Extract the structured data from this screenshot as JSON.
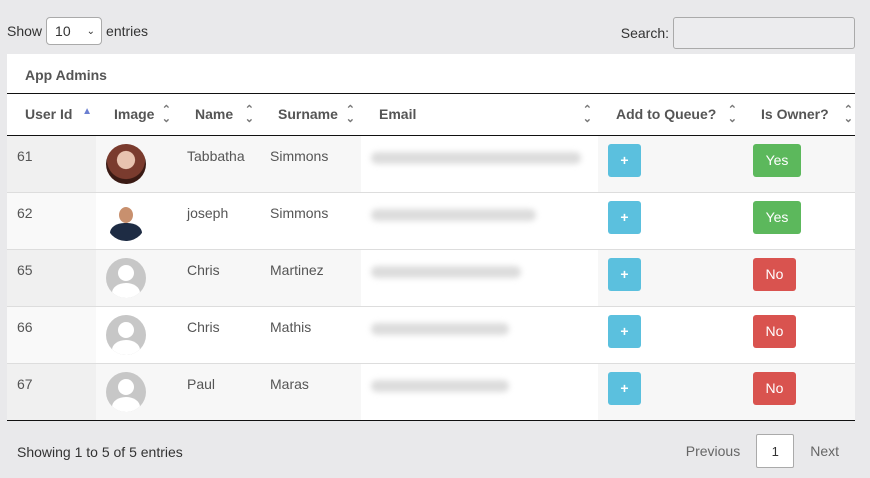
{
  "length_menu": {
    "prefix": "Show",
    "value": "10",
    "suffix": "entries"
  },
  "search": {
    "label": "Search:",
    "value": ""
  },
  "panel": {
    "title": "App Admins"
  },
  "table": {
    "columns": [
      "User Id",
      "Image",
      "Name",
      "Surname",
      "Email",
      "Add to Queue?",
      "Is Owner?"
    ],
    "rows": [
      {
        "id": "61",
        "avatar": "photo-woman",
        "name": "Tabbatha",
        "surname": "Simmons",
        "add": "+",
        "owner": "Yes"
      },
      {
        "id": "62",
        "avatar": "photo-man",
        "name": "joseph",
        "surname": "Simmons",
        "add": "+",
        "owner": "Yes"
      },
      {
        "id": "65",
        "avatar": "default-avatar",
        "name": "Chris",
        "surname": "Martinez",
        "add": "+",
        "owner": "No"
      },
      {
        "id": "66",
        "avatar": "default-avatar",
        "name": "Chris",
        "surname": "Mathis",
        "add": "+",
        "owner": "No"
      },
      {
        "id": "67",
        "avatar": "default-avatar",
        "name": "Paul",
        "surname": "Maras",
        "add": "+",
        "owner": "No"
      }
    ]
  },
  "footer": {
    "info": "Showing 1 to 5 of 5 entries",
    "previous": "Previous",
    "page": "1",
    "next": "Next"
  },
  "colors": {
    "add_button": "#5bc0de",
    "yes": "#5cb85c",
    "no": "#d9534f",
    "sort_active": "#6b7fd1"
  }
}
